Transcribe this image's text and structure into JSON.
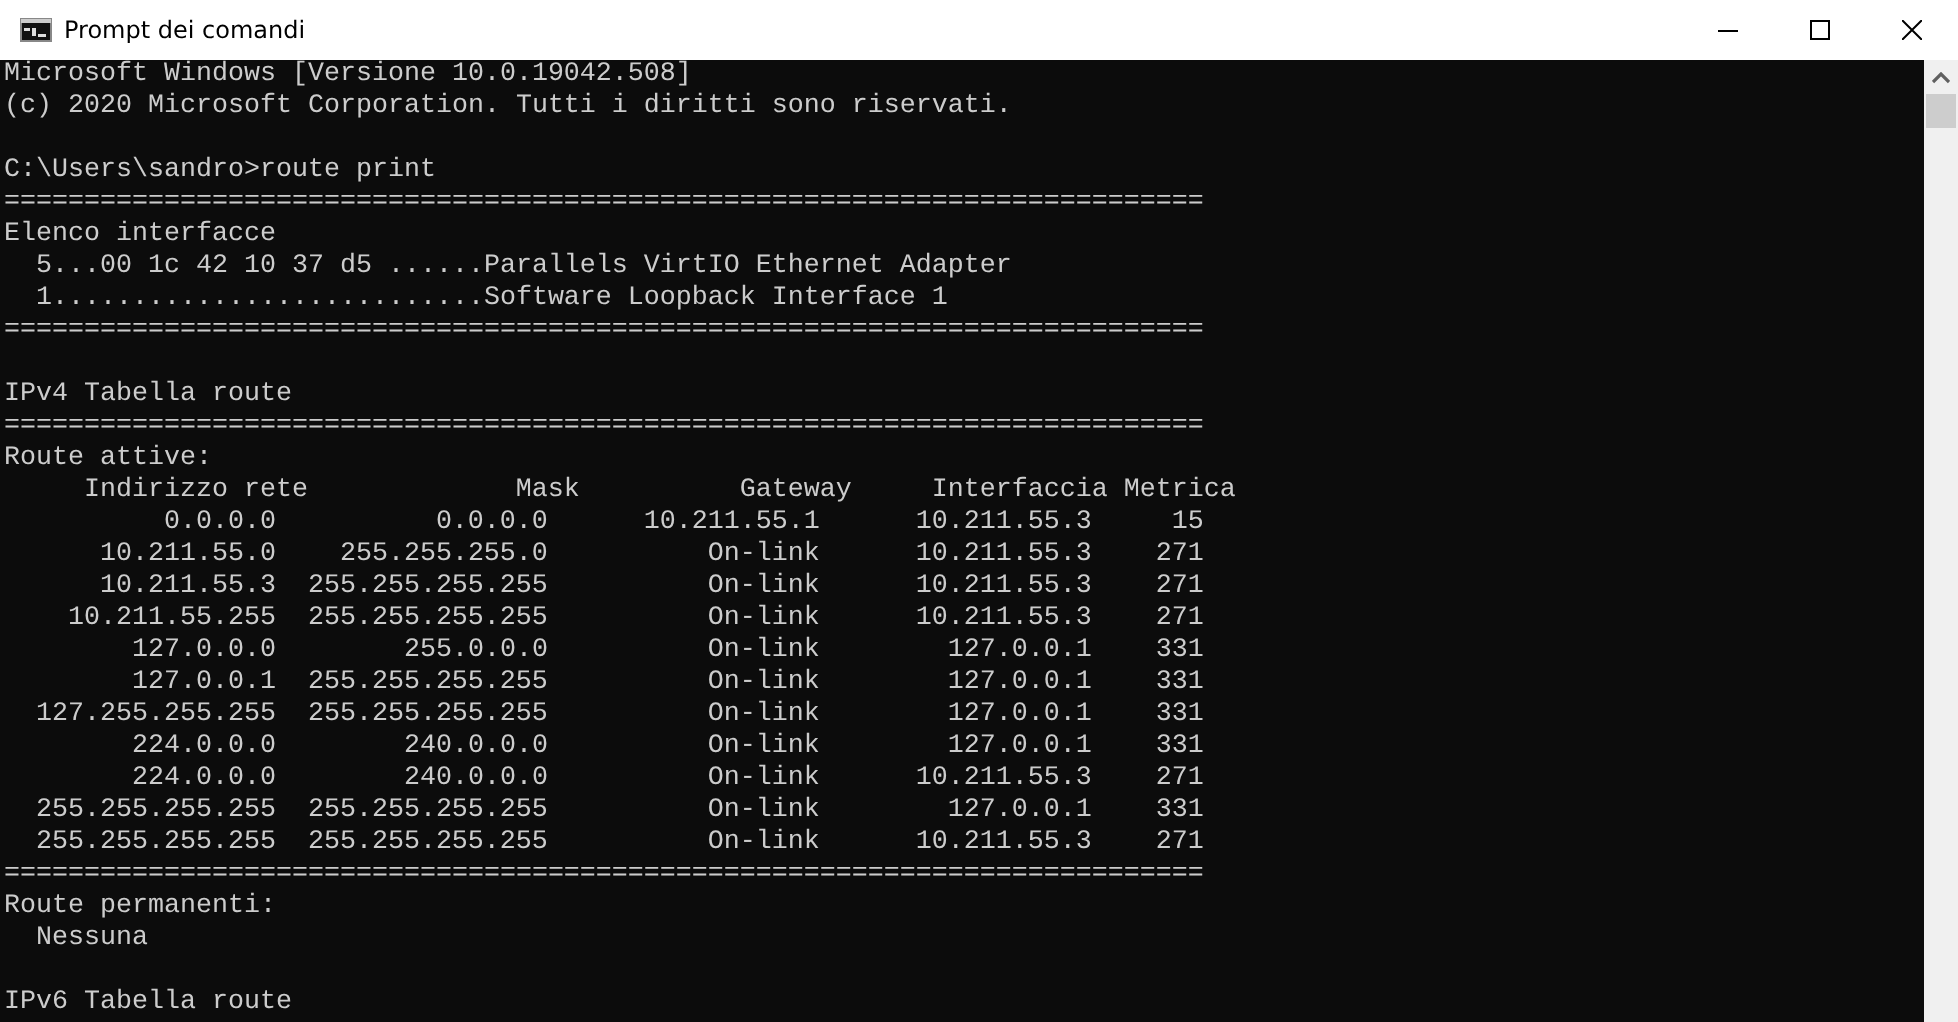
{
  "window": {
    "title": "Prompt dei comandi"
  },
  "console": {
    "lines": [
      {
        "kind": "text",
        "text": "Microsoft Windows [Versione 10.0.19042.508]"
      },
      {
        "kind": "text",
        "text": "(c) 2020 Microsoft Corporation. Tutti i diritti sono riservati."
      },
      {
        "kind": "blank"
      },
      {
        "kind": "text",
        "text": "C:\\Users\\sandro>route print"
      },
      {
        "kind": "rule",
        "text": "==========================================================================="
      },
      {
        "kind": "text",
        "text": "Elenco interfacce"
      },
      {
        "kind": "text",
        "text": "  5...00 1c 42 10 37 d5 ......Parallels VirtIO Ethernet Adapter"
      },
      {
        "kind": "text",
        "text": "  1...........................Software Loopback Interface 1"
      },
      {
        "kind": "rule",
        "text": "==========================================================================="
      },
      {
        "kind": "blank"
      },
      {
        "kind": "text",
        "text": "IPv4 Tabella route"
      },
      {
        "kind": "rule",
        "text": "==========================================================================="
      },
      {
        "kind": "text",
        "text": "Route attive:"
      },
      {
        "kind": "route_header",
        "cells": [
          "Indirizzo rete",
          "Mask",
          "Gateway",
          "Interfaccia",
          "Metrica"
        ]
      },
      {
        "kind": "route_row",
        "cells": [
          "0.0.0.0",
          "0.0.0.0",
          "10.211.55.1",
          "10.211.55.3",
          "15"
        ]
      },
      {
        "kind": "route_row",
        "cells": [
          "10.211.55.0",
          "255.255.255.0",
          "On-link",
          "10.211.55.3",
          "271"
        ]
      },
      {
        "kind": "route_row",
        "cells": [
          "10.211.55.3",
          "255.255.255.255",
          "On-link",
          "10.211.55.3",
          "271"
        ]
      },
      {
        "kind": "route_row",
        "cells": [
          "10.211.55.255",
          "255.255.255.255",
          "On-link",
          "10.211.55.3",
          "271"
        ]
      },
      {
        "kind": "route_row",
        "cells": [
          "127.0.0.0",
          "255.0.0.0",
          "On-link",
          "127.0.0.1",
          "331"
        ]
      },
      {
        "kind": "route_row",
        "cells": [
          "127.0.0.1",
          "255.255.255.255",
          "On-link",
          "127.0.0.1",
          "331"
        ]
      },
      {
        "kind": "route_row",
        "cells": [
          "127.255.255.255",
          "255.255.255.255",
          "On-link",
          "127.0.0.1",
          "331"
        ]
      },
      {
        "kind": "route_row",
        "cells": [
          "224.0.0.0",
          "240.0.0.0",
          "On-link",
          "127.0.0.1",
          "331"
        ]
      },
      {
        "kind": "route_row",
        "cells": [
          "224.0.0.0",
          "240.0.0.0",
          "On-link",
          "10.211.55.3",
          "271"
        ]
      },
      {
        "kind": "route_row",
        "cells": [
          "255.255.255.255",
          "255.255.255.255",
          "On-link",
          "127.0.0.1",
          "331"
        ]
      },
      {
        "kind": "route_row",
        "cells": [
          "255.255.255.255",
          "255.255.255.255",
          "On-link",
          "10.211.55.3",
          "271"
        ]
      },
      {
        "kind": "rule",
        "text": "==========================================================================="
      },
      {
        "kind": "text",
        "text": "Route permanenti:"
      },
      {
        "kind": "text",
        "text": "  Nessuna"
      },
      {
        "kind": "blank"
      },
      {
        "kind": "text",
        "text": "IPv6 Tabella route"
      }
    ]
  }
}
